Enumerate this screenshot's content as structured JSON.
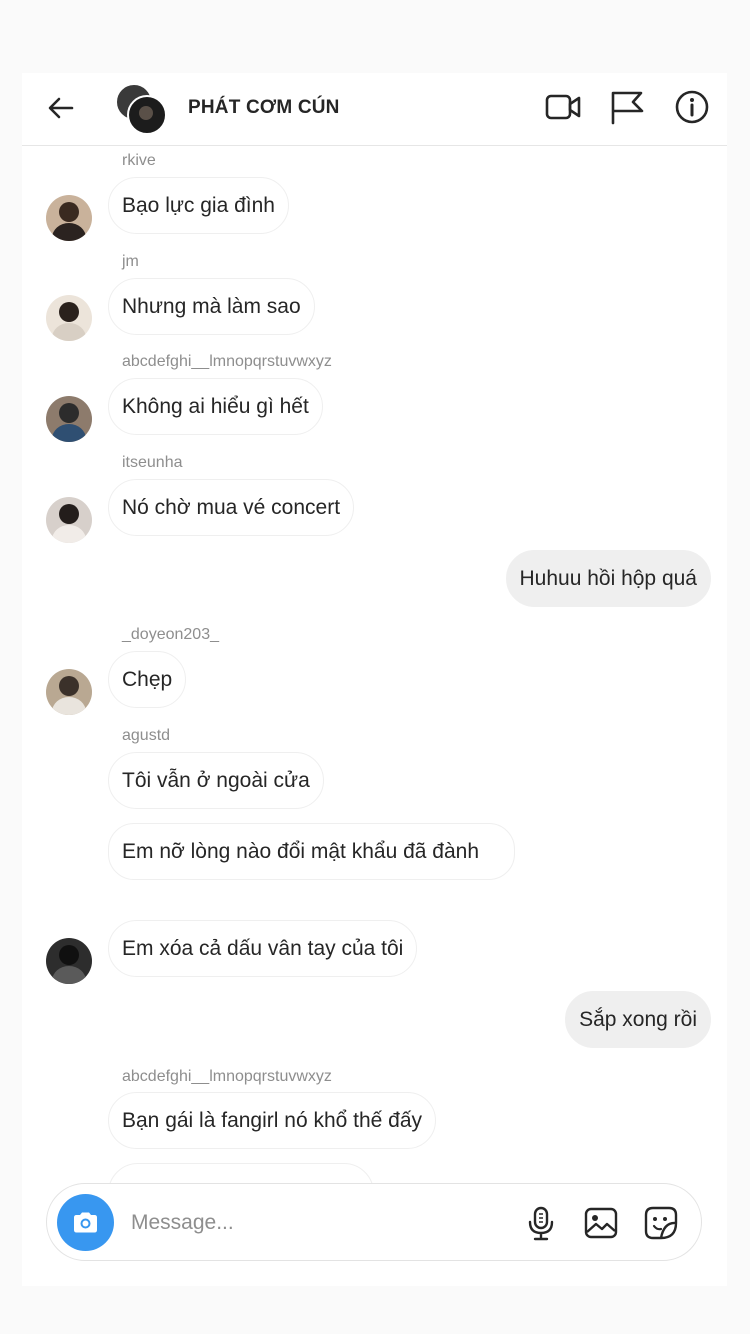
{
  "header": {
    "title": "PHÁT CƠM CÚN",
    "icons": [
      "back-arrow-icon",
      "group-avatar",
      "video-call-icon",
      "flag-icon",
      "info-icon"
    ]
  },
  "messages": [
    {
      "username": "rkive",
      "text": "Bạo lực gia đình"
    },
    {
      "username": "jm",
      "text": "Nhưng mà làm sao"
    },
    {
      "username": "abcdefghi__lmnopqrstuvwxyz",
      "text": "Không ai hiểu gì hết"
    },
    {
      "username": "itseunha",
      "text": "Nó chờ mua vé concert"
    },
    {
      "mine": true,
      "text": "Huhuu hồi hộp quá"
    },
    {
      "username": "_doyeon203_",
      "text": "Chẹp"
    },
    {
      "username": "agustd",
      "text": "Tôi vẫn ở ngoài cửa"
    },
    {
      "text": "Em nỡ lòng nào đổi mật khẩu đã đành"
    },
    {
      "text": "Em xóa cả dấu vân tay của tôi"
    },
    {
      "mine": true,
      "text": "Sắp xong rồi"
    },
    {
      "username": "abcdefghi__lmnopqrstuvwxyz",
      "text": "Bạn gái là fangirl nó khổ thế đấy"
    }
  ],
  "composer": {
    "placeholder": "Message...",
    "icons": [
      "camera-icon",
      "microphone-icon",
      "gallery-icon",
      "sticker-icon"
    ]
  },
  "colors": {
    "accent": "#3897f0",
    "my_bubble": "#efefef",
    "username_gray": "#8e8e8e"
  }
}
